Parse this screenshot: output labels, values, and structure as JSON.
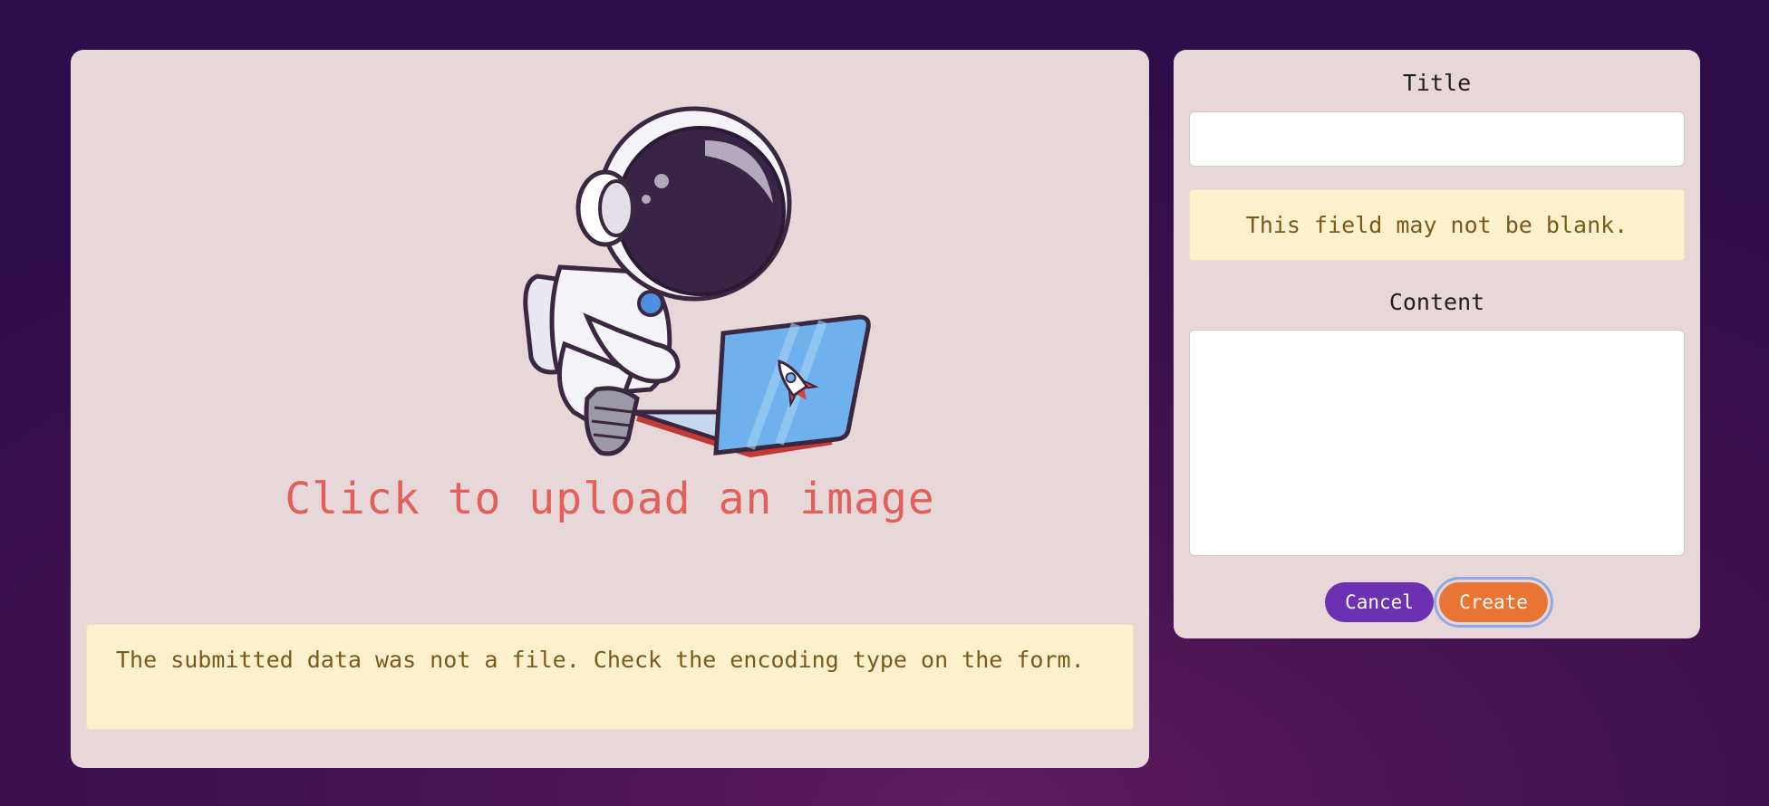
{
  "upload": {
    "prompt": "Click to upload an image",
    "error": "The submitted data was not a file. Check the encoding type on the form."
  },
  "form": {
    "title_label": "Title",
    "title_value": "",
    "title_error": "This field may not be blank.",
    "content_label": "Content",
    "content_value": "",
    "cancel_label": "Cancel",
    "create_label": "Create"
  },
  "colors": {
    "upload_prompt": "#e2605a",
    "alert_bg": "#fdf1cd",
    "cancel_button": "#6c30b3",
    "create_button": "#ea7433"
  },
  "icons": {
    "upload_illustration": "astronaut-with-laptop-illustration"
  }
}
